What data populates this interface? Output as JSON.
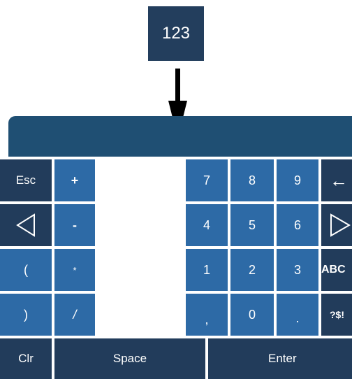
{
  "callout": {
    "label": "123"
  },
  "keyboard": {
    "left_keys": {
      "esc": "Esc",
      "plus": "+",
      "minus": "-",
      "open_paren": "(",
      "asterisk": "*",
      "close_paren": ")",
      "slash": "/"
    },
    "numpad": {
      "row1": [
        "7",
        "8",
        "9"
      ],
      "row2": [
        "4",
        "5",
        "6"
      ],
      "row3": [
        "1",
        "2",
        "3"
      ],
      "row4": [
        ",",
        "0",
        "."
      ]
    },
    "right_keys": {
      "backspace": "←",
      "abc": "ABC",
      "symbols": "?$!"
    },
    "bottom_row": {
      "clear": "Clr",
      "space": "Space",
      "enter": "Enter"
    }
  },
  "colors": {
    "dark_key": "#223c5b",
    "blue_key": "#2d6aa6",
    "display_bar": "#1f4f73"
  }
}
